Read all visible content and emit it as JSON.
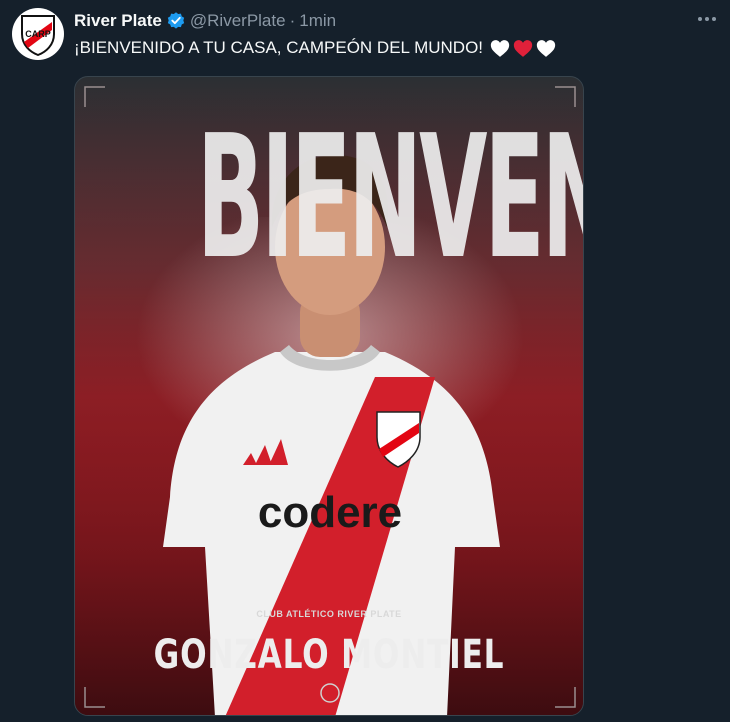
{
  "account": {
    "display_name": "River Plate",
    "handle": "@RiverPlate",
    "separator": "·",
    "time": "1min"
  },
  "tweet": {
    "text": "¡BIENVENIDO A TU CASA, CAMPEÓN DEL MUNDO!",
    "emojis": [
      "white-heart",
      "red-heart",
      "white-heart"
    ]
  },
  "media": {
    "headline": "BIENVENIDO",
    "club_caption": "CLUB ATLÉTICO RIVER PLATE",
    "player_name": "GONZALO MONTIEL",
    "avatar_logo_text": "CARP",
    "sponsor_text": "codere"
  },
  "colors": {
    "background": "#15202b",
    "verified": "#1d9bf0",
    "brand_red": "#e30613",
    "muted": "#8b98a5"
  },
  "icons": {
    "more": "more-dots-icon",
    "verified": "verified-badge-icon"
  }
}
